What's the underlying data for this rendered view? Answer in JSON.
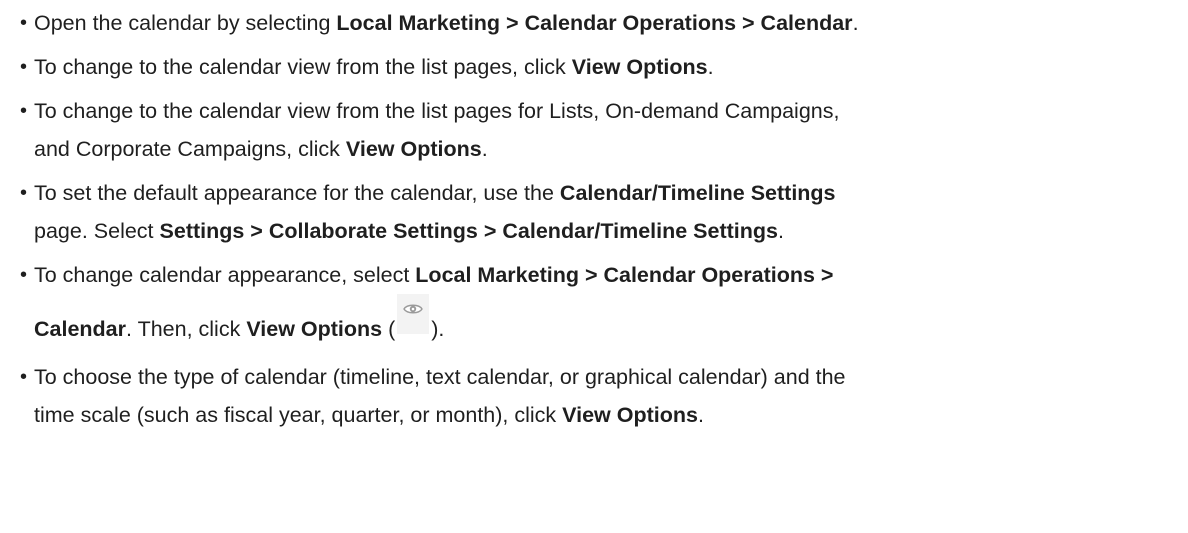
{
  "bullets": [
    {
      "parts": [
        {
          "t": "Open the calendar by selecting ",
          "b": false
        },
        {
          "t": "Local Marketing > Calendar Operations > Calendar",
          "b": true
        },
        {
          "t": ".",
          "b": false
        }
      ]
    },
    {
      "parts": [
        {
          "t": "To change to the calendar view from the list pages, click ",
          "b": false
        },
        {
          "t": "View Options",
          "b": true
        },
        {
          "t": ".",
          "b": false
        }
      ]
    },
    {
      "line1": "To change to the calendar view from the list pages for Lists, On-demand Campaigns,",
      "line2_pre": "and Corporate Campaigns, click ",
      "line2_bold": "View Options",
      "line2_post": "."
    },
    {
      "line1_pre": "To set the default appearance for the calendar, use the ",
      "line1_bold": "Calendar/Timeline Settings",
      "line2_pre": "page. Select ",
      "line2_bold": "Settings > Collaborate Settings > Calendar/Timeline Settings",
      "line2_post": "."
    },
    {
      "line1_pre": "To change calendar appearance, select ",
      "line1_bold": "Local Marketing > Calendar Operations >",
      "line2_bold1": "Calendar",
      "line2_mid": ". Then, click ",
      "line2_bold2": "View Options",
      "line2_open": " (",
      "line2_icon": "eye-icon",
      "line2_close": ")."
    },
    {
      "line1": "To choose the type of calendar (timeline, text calendar, or graphical calendar) and the",
      "line2_pre": "time scale (such as fiscal year, quarter, or month), click ",
      "line2_bold": "View Options",
      "line2_post": "."
    }
  ],
  "colors": {
    "text": "#1f1f1f",
    "icon_bg": "#f3f3f3",
    "icon_fg": "#9a9a9a"
  }
}
